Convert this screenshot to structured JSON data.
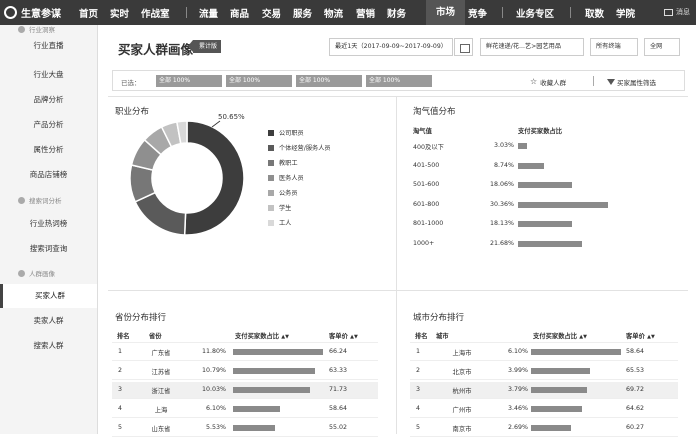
{
  "nav": {
    "logo": "生意参谋",
    "items": [
      "首页",
      "实时",
      "作战室",
      "流量",
      "商品",
      "交易",
      "服务",
      "物流",
      "营销",
      "财务",
      "市场",
      "竞争",
      "业务专区",
      "取数",
      "学院"
    ],
    "active": "市场",
    "message": "消息"
  },
  "sidebar": {
    "group_top": "行业洞察",
    "items_top": [
      "行业直播",
      "行业大盘",
      "品牌分析",
      "产品分析",
      "属性分析",
      "商品店铺榜"
    ],
    "group_search": "搜索词分析",
    "items_search": [
      "行业热词榜",
      "搜索词查询"
    ],
    "group_people": "人群画像",
    "items_people": [
      "买家人群",
      "卖家人群",
      "搜索人群"
    ],
    "active": "买家人群"
  },
  "header": {
    "title": "买家人群画像",
    "badge": "累计版",
    "date_range": "最近1天（2017-09-09~2017-09-09）",
    "category": "鲜花速递/花...艺>园艺用品",
    "terminal": "所有终端",
    "region": "全网"
  },
  "selection": {
    "label": "已选：",
    "chips": [
      "全部 100%",
      "全部 100%",
      "全部 100%",
      "全部 100%"
    ],
    "favorite": "收藏人群",
    "filter": "买家属性筛选"
  },
  "occupation": {
    "title": "职业分布",
    "top_label": "50.65%",
    "legend": [
      "公司职员",
      "个体经营/服务人员",
      "教职工",
      "医务人员",
      "公务员",
      "学生",
      "工人"
    ],
    "colors": [
      "#3d3d3d",
      "#5a5a5a",
      "#777777",
      "#8f8f8f",
      "#a8a8a8",
      "#c2c2c2",
      "#d9d9d9"
    ]
  },
  "taoqi": {
    "title": "淘气值分布",
    "col1": "淘气值",
    "col2": "支付买家数占比",
    "rows": [
      {
        "range": "400及以下",
        "pct": "3.03%"
      },
      {
        "range": "401-500",
        "pct": "8.74%"
      },
      {
        "range": "501-600",
        "pct": "18.06%"
      },
      {
        "range": "601-800",
        "pct": "30.36%"
      },
      {
        "range": "801-1000",
        "pct": "18.13%"
      },
      {
        "range": "1000+",
        "pct": "21.68%"
      }
    ]
  },
  "province": {
    "title": "省份分布排行",
    "cols": [
      "排名",
      "省份",
      "支付买家数占比",
      "客单价"
    ],
    "rows": [
      {
        "rank": "1",
        "name": "广东省",
        "pct": "11.80%",
        "price": "66.24"
      },
      {
        "rank": "2",
        "name": "江苏省",
        "pct": "10.79%",
        "price": "63.33"
      },
      {
        "rank": "3",
        "name": "浙江省",
        "pct": "10.03%",
        "price": "71.73"
      },
      {
        "rank": "4",
        "name": "上海",
        "pct": "6.10%",
        "price": "58.64"
      },
      {
        "rank": "5",
        "name": "山东省",
        "pct": "5.53%",
        "price": "55.02"
      }
    ]
  },
  "city": {
    "title": "城市分布排行",
    "cols": [
      "排名",
      "城市",
      "支付买家数占比",
      "客单价"
    ],
    "rows": [
      {
        "rank": "1",
        "name": "上海市",
        "pct": "6.10%",
        "price": "58.64"
      },
      {
        "rank": "2",
        "name": "北京市",
        "pct": "3.99%",
        "price": "65.53"
      },
      {
        "rank": "3",
        "name": "杭州市",
        "pct": "3.79%",
        "price": "69.72"
      },
      {
        "rank": "4",
        "name": "广州市",
        "pct": "3.46%",
        "price": "64.62"
      },
      {
        "rank": "5",
        "name": "南京市",
        "pct": "2.69%",
        "price": "60.27"
      }
    ]
  },
  "chart_data": [
    {
      "type": "pie",
      "title": "职业分布",
      "categories": [
        "公司职员",
        "个体经营/服务人员",
        "教职工",
        "医务人员",
        "公务员",
        "学生",
        "工人"
      ],
      "values": [
        50.65,
        17.5,
        10.5,
        8.0,
        6.0,
        4.5,
        2.85
      ]
    },
    {
      "type": "bar",
      "title": "淘气值分布",
      "categories": [
        "400及以下",
        "401-500",
        "501-600",
        "601-800",
        "801-1000",
        "1000+"
      ],
      "values": [
        3.03,
        8.74,
        18.06,
        30.36,
        18.13,
        21.68
      ]
    },
    {
      "type": "bar",
      "title": "省份分布排行",
      "categories": [
        "广东省",
        "江苏省",
        "浙江省",
        "上海",
        "山东省"
      ],
      "values": [
        11.8,
        10.79,
        10.03,
        6.1,
        5.53
      ]
    },
    {
      "type": "bar",
      "title": "城市分布排行",
      "categories": [
        "上海市",
        "北京市",
        "杭州市",
        "广州市",
        "南京市"
      ],
      "values": [
        6.1,
        3.99,
        3.79,
        3.46,
        2.69
      ]
    }
  ]
}
